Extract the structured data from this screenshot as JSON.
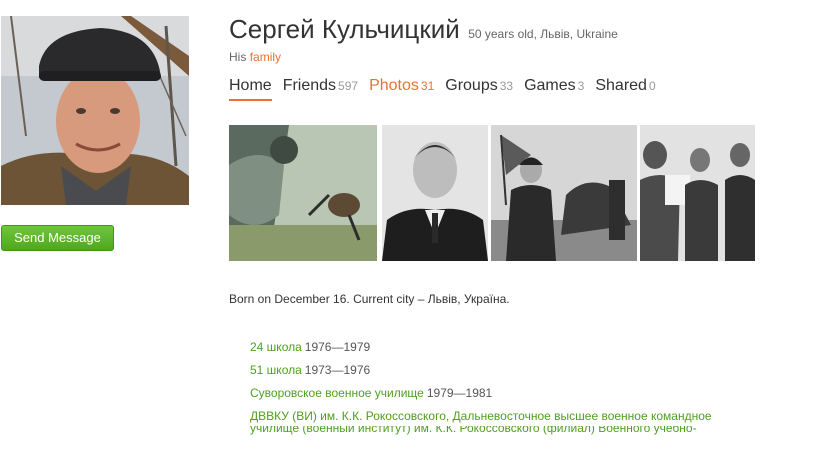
{
  "profile": {
    "name": "Сергей Кульчицкий",
    "meta": "50 years old, Львів, Ukraine",
    "relation_prefix": "His",
    "relation_link": "family",
    "send_message": "Send Message"
  },
  "tabs": [
    {
      "label": "Home",
      "count": ""
    },
    {
      "label": "Friends",
      "count": "597"
    },
    {
      "label": "Photos",
      "count": "31"
    },
    {
      "label": "Groups",
      "count": "33"
    },
    {
      "label": "Games",
      "count": "3"
    },
    {
      "label": "Shared",
      "count": "0"
    }
  ],
  "about": {
    "born": "Born on December 16. Current city – Львів, Україна."
  },
  "education": [
    {
      "school": "24 школа",
      "years": "1976—1979"
    },
    {
      "school": "51 школа",
      "years": "1973—1976"
    },
    {
      "school": "Суворовское военное училище",
      "years": "1979—1981"
    },
    {
      "school": "ДВВКУ (ВИ) им. К.К. Рокоссовского, Дальневосточное высшее военное командное",
      "years": ""
    },
    {
      "school": "училище (военный институт) им. К.К. Рокоссовского (филиал) Военного учебно-",
      "years": ""
    }
  ],
  "colors": {
    "accent_orange": "#eb722e",
    "link_green": "#4fa01e",
    "button_green": "#5cb82a"
  }
}
